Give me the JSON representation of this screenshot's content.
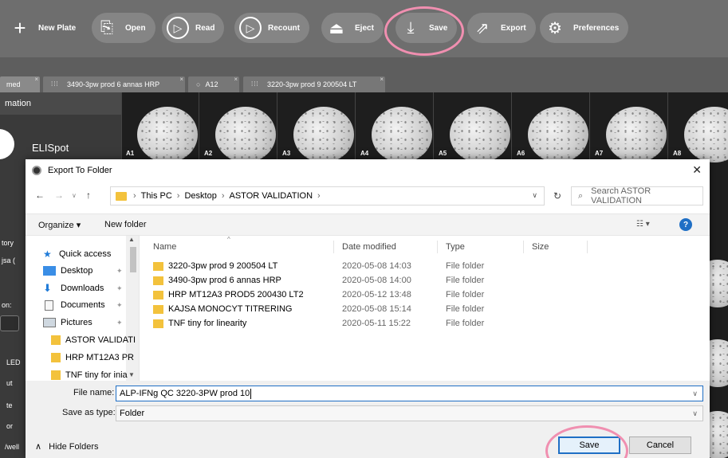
{
  "toolbar": {
    "buttons": [
      {
        "label": "New Plate",
        "icon": "plus-icon"
      },
      {
        "label": "Open",
        "icon": "open-file-icon"
      },
      {
        "label": "Read",
        "icon": "play-icon"
      },
      {
        "label": "Recount",
        "icon": "replay-icon"
      },
      {
        "label": "Eject",
        "icon": "eject-icon"
      },
      {
        "label": "Save",
        "icon": "save-icon"
      },
      {
        "label": "Export",
        "icon": "export-icon"
      },
      {
        "label": "Preferences",
        "icon": "gear-icon"
      }
    ],
    "highlight_color": "#f08fb0"
  },
  "tabs": [
    {
      "label": "med"
    },
    {
      "label": "3490-3pw prod 6 annas HRP"
    },
    {
      "label": "A12"
    },
    {
      "label": "3220-3pw prod 9 200504 LT"
    }
  ],
  "left_panel": {
    "header": "mation",
    "plate_type": "ELISpot",
    "items": [
      "tory",
      "jsa (",
      "on:",
      "LED",
      "ut",
      "te",
      "or",
      "/well"
    ]
  },
  "plate": {
    "wells": [
      "A1",
      "A2",
      "A3",
      "A4",
      "A5",
      "A6",
      "A7",
      "A8"
    ]
  },
  "dialog": {
    "title": "Export To Folder",
    "close_glyph": "✕",
    "address": {
      "crumbs": [
        "This PC",
        "Desktop",
        "ASTOR VALIDATION"
      ]
    },
    "search_placeholder": "Search ASTOR VALIDATION",
    "commands": {
      "organize": "Organize ▾",
      "new_folder": "New folder"
    },
    "nav": [
      {
        "label": "Quick access",
        "icon": "star-icon",
        "pinned": false
      },
      {
        "label": "Desktop",
        "icon": "desktop-icon",
        "pinned": true
      },
      {
        "label": "Downloads",
        "icon": "downloads-icon",
        "pinned": true
      },
      {
        "label": "Documents",
        "icon": "documents-icon",
        "pinned": true
      },
      {
        "label": "Pictures",
        "icon": "pictures-icon",
        "pinned": true
      },
      {
        "label": "ASTOR VALIDATI",
        "icon": "folder-icon",
        "pinned": false
      },
      {
        "label": "HRP MT12A3 PR",
        "icon": "folder-icon",
        "pinned": false
      },
      {
        "label": "TNF tiny for inia",
        "icon": "folder-icon",
        "pinned": false
      }
    ],
    "columns": [
      "Name",
      "Date modified",
      "Type",
      "Size"
    ],
    "files": [
      {
        "name": "3220-3pw prod 9 200504 LT",
        "date": "2020-05-08 14:03",
        "type": "File folder"
      },
      {
        "name": "3490-3pw prod 6 annas HRP",
        "date": "2020-05-08 14:00",
        "type": "File folder"
      },
      {
        "name": "HRP MT12A3 PROD5 200430 LT2",
        "date": "2020-05-12 13:48",
        "type": "File folder"
      },
      {
        "name": "KAJSA MONOCYT TITRERING",
        "date": "2020-05-08 15:14",
        "type": "File folder"
      },
      {
        "name": "TNF tiny for linearity",
        "date": "2020-05-11 15:22",
        "type": "File folder"
      }
    ],
    "file_name_label": "File name:",
    "file_name_value": "ALP-IFNg QC 3220-3PW prod 10",
    "save_type_label": "Save as type:",
    "save_type_value": "Folder",
    "hide_folders": "Hide Folders",
    "save_button": "Save",
    "cancel_button": "Cancel"
  }
}
